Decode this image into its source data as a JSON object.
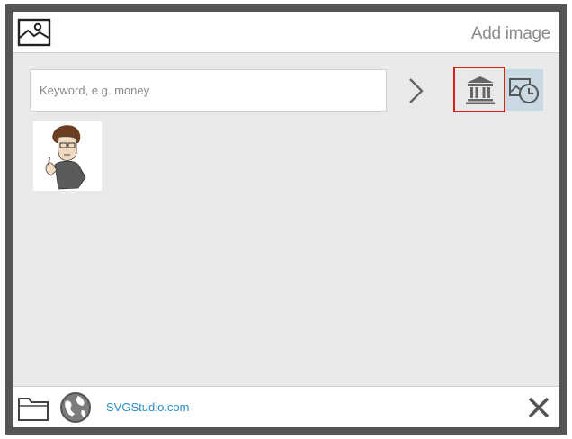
{
  "dialog": {
    "title": "Add image"
  },
  "search": {
    "placeholder": "Keyword, e.g. money",
    "value": ""
  },
  "toolbar": {
    "go_icon": "chevron-right-icon",
    "library_icon": "library-building-icon",
    "recent_icon": "image-clock-icon",
    "selected": "library"
  },
  "results": [
    {
      "icon": "cartoon-person-thumbnail"
    }
  ],
  "footer": {
    "folder_icon": "folder-icon",
    "globe_icon": "globe-icon",
    "link_label": "SVGStudio.com",
    "close_icon": "close-icon"
  },
  "colors": {
    "highlight_border": "#dd1c1c",
    "recent_bg": "#c9d9e4",
    "link": "#2b8fc5",
    "panel_bg": "#e9e9e9"
  }
}
